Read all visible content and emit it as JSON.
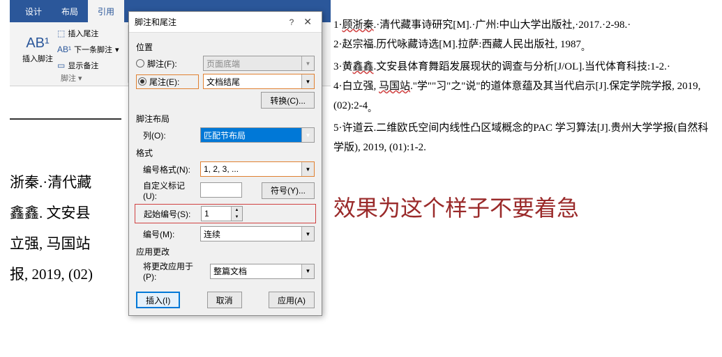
{
  "ribbon": {
    "tabs": [
      "设计",
      "布局",
      "引用"
    ],
    "active_tab": "引用",
    "big_button": "插入脚注",
    "small_buttons": [
      "插入尾注",
      "下一条脚注",
      "显示备注"
    ],
    "group_label": "脚注"
  },
  "doc_background": [
    "浙秦.·清代藏",
    "鑫鑫. 文安县",
    "",
    "立强, 马国站",
    "报, 2019, (02)"
  ],
  "dialog": {
    "title": "脚注和尾注",
    "help": "?",
    "sections": {
      "position": "位置",
      "layout": "脚注布局",
      "format": "格式",
      "apply": "应用更改"
    },
    "footnote_radio": "脚注(F):",
    "footnote_value": "页面底端",
    "endnote_radio": "尾注(E):",
    "endnote_value": "文档结尾",
    "convert_btn": "转换(C)...",
    "column_label": "列(O):",
    "column_value": "匹配节布局",
    "number_format_label": "编号格式(N):",
    "number_format_value": "1, 2, 3, ...",
    "custom_mark_label": "自定义标记(U):",
    "symbol_btn": "符号(Y)...",
    "start_at_label": "起始编号(S):",
    "start_at_value": "1",
    "numbering_label": "编号(M):",
    "numbering_value": "连续",
    "apply_to_label": "将更改应用于(P):",
    "apply_to_value": "整篇文档",
    "insert_btn": "插入(I)",
    "cancel_btn": "取消",
    "apply_btn": "应用(A)"
  },
  "references": [
    {
      "n": "1",
      "text": "顾浙秦.·清代藏事诗研究[M].·广州:中山大学出版社,·2017.·2-98."
    },
    {
      "n": "2",
      "text": "赵宗福.历代咏藏诗选[M].拉萨:西藏人民出版社, 1987。"
    },
    {
      "n": "3",
      "text": "黄鑫鑫.文安县体育舞蹈发展现状的调查与分析[J/OL].当代体育科技:1-2."
    },
    {
      "n": "4",
      "text": "白立强, 马国站.\"学\"\"习\"之\"说\"的道体意蕴及其当代启示[J].保定学院学报, 2019, (02):2-4。"
    },
    {
      "n": "5",
      "text": "许道云.二维欧氏空间内线性凸区域概念的PAC 学习算法[J].贵州大学学报(自然科学版), 2019, (01):1-2."
    }
  ],
  "result_caption": "效果为这个样子不要着急"
}
